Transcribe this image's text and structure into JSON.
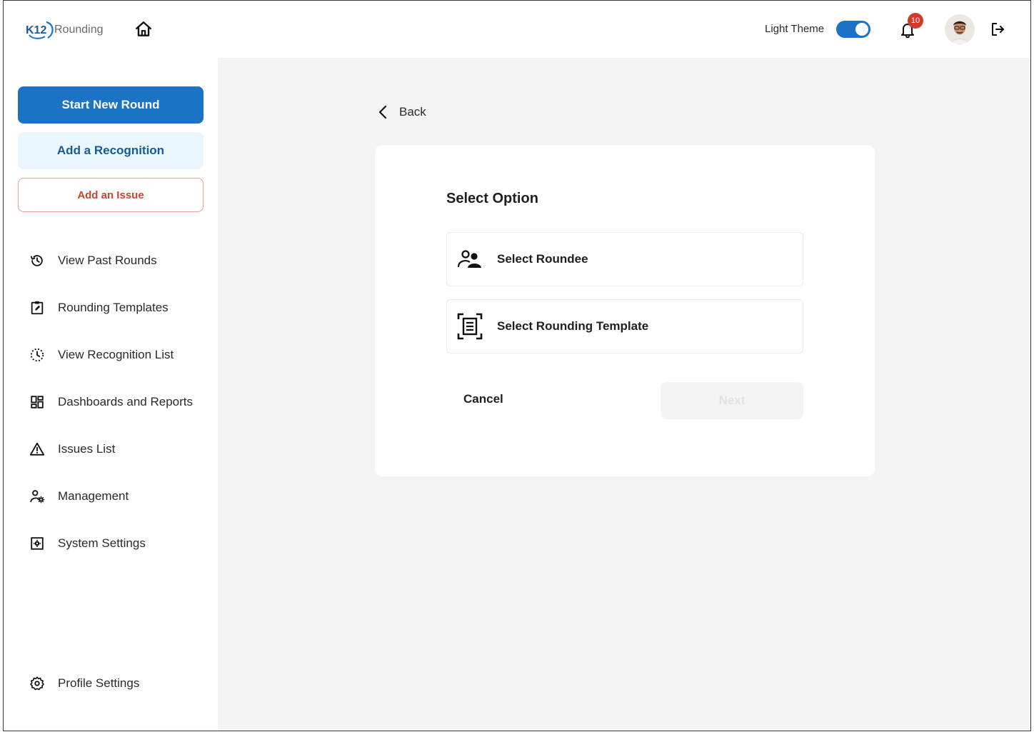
{
  "header": {
    "logo_text": "K12",
    "logo_suffix": "Rounding",
    "theme_label": "Light Theme",
    "theme_on": true,
    "notification_count": "10",
    "accent": "#1a73c5",
    "badge_color": "#d33a2c"
  },
  "sidebar": {
    "start_round": "Start New Round",
    "add_recognition": "Add a Recognition",
    "add_issue": "Add an Issue",
    "items": [
      {
        "label": "View Past Rounds",
        "icon": "history-icon"
      },
      {
        "label": "Rounding Templates",
        "icon": "clipboard-edit-icon"
      },
      {
        "label": "View Recognition List",
        "icon": "dotted-clock-icon"
      },
      {
        "label": "Dashboards and Reports",
        "icon": "dashboard-icon"
      },
      {
        "label": "Issues List",
        "icon": "warning-icon"
      },
      {
        "label": "Management",
        "icon": "user-gear-icon"
      },
      {
        "label": "System Settings",
        "icon": "settings-box-icon"
      }
    ],
    "profile_settings": "Profile Settings"
  },
  "main": {
    "back_label": "Back",
    "card": {
      "title": "Select Option",
      "options": [
        {
          "label": "Select Roundee",
          "icon": "users-icon"
        },
        {
          "label": "Select Rounding Template",
          "icon": "document-scan-icon"
        }
      ],
      "cancel_label": "Cancel",
      "next_label": "Next"
    }
  }
}
